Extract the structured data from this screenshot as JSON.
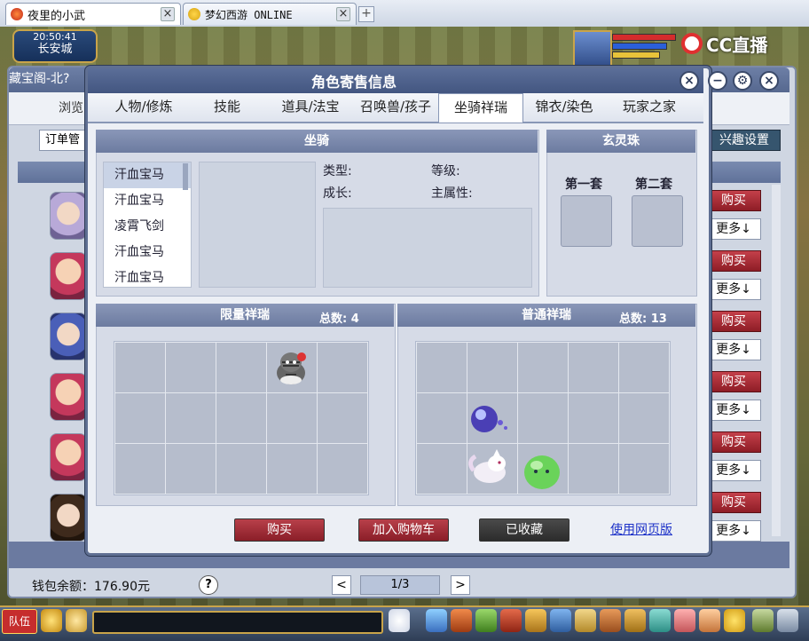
{
  "browser": {
    "tabs": [
      {
        "label": "夜里的小武",
        "close": "×"
      },
      {
        "label": "梦幻西游 ONLINE",
        "close": "×"
      }
    ],
    "new_tab": "+"
  },
  "hud": {
    "time": "20:50:41",
    "location": "长安城",
    "stream_brand": "CC直播"
  },
  "shop": {
    "title": "藏宝阁-北?",
    "browse_label": "浏览",
    "order_label": "订单管",
    "fun_settings": "兴趣设置",
    "buy_label": "购买",
    "more_label": "更多↓",
    "wallet": "钱包余额：176.90元",
    "help": "?",
    "page": "1/3",
    "prev": "<",
    "next": ">"
  },
  "modal": {
    "title": "角色寄售信息",
    "tabs": [
      "人物/修炼",
      "技能",
      "道具/法宝",
      "召唤兽/孩子",
      "坐骑祥瑞",
      "锦衣/染色",
      "玩家之家"
    ],
    "active_tab": "坐骑祥瑞",
    "mount_section": "坐骑",
    "mounts": [
      "汗血宝马",
      "汗血宝马",
      "凌霄飞剑",
      "汗血宝马",
      "汗血宝马"
    ],
    "info": {
      "type": "类型:",
      "level": "等级:",
      "growth": "成长:",
      "main_attr": "主属性:"
    },
    "orb_section": "玄灵珠",
    "orb_sets": [
      "第一套",
      "第二套"
    ],
    "limited_section": "限量祥瑞",
    "limited_count": "总数: 4",
    "normal_section": "普通祥瑞",
    "normal_count": "总数: 13",
    "buttons": {
      "buy": "购买",
      "add_cart": "加入购物车",
      "saved": "已收藏",
      "web": "使用网页版"
    },
    "controls": {
      "close": "×",
      "minimize": "−",
      "settings": "⚙"
    }
  },
  "taskbar": {
    "team": "队伍"
  },
  "colors": {
    "modal_header": "#4f628c",
    "buy_red": "#a4303a",
    "saved_dark": "#3e3e3e",
    "link_blue": "#1d32c8"
  }
}
